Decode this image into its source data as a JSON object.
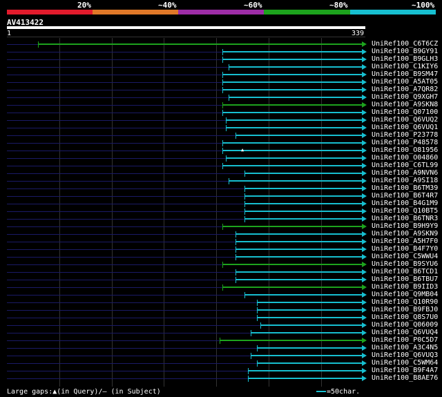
{
  "legend": {
    "segments": [
      {
        "label": "20%",
        "color": "#e21b2c"
      },
      {
        "label": "~40%",
        "color": "#e07828"
      },
      {
        "label": "~60%",
        "color": "#9d2da6"
      },
      {
        "label": "~80%",
        "color": "#1da31d"
      },
      {
        "label": "~100%",
        "color": "#17bfd0"
      }
    ]
  },
  "query": {
    "id": "AV413422",
    "start": "1",
    "end": "339",
    "length": 339
  },
  "colors": {
    "cyan": "#17bfd0",
    "green": "#1da31d",
    "track": "#1a1a66"
  },
  "hits": [
    {
      "name": "UniRef100_C6T6CZ",
      "start": 30,
      "color": "green"
    },
    {
      "name": "UniRef100_B9GY91",
      "start": 206,
      "color": "cyan"
    },
    {
      "name": "UniRef100_B9GLH3",
      "start": 206,
      "color": "cyan"
    },
    {
      "name": "UniRef100_C1KIY6",
      "start": 212,
      "color": "cyan"
    },
    {
      "name": "UniRef100_B9SM47",
      "start": 206,
      "color": "cyan"
    },
    {
      "name": "UniRef100_A5AT05",
      "start": 206,
      "color": "cyan"
    },
    {
      "name": "UniRef100_A7QR82",
      "start": 206,
      "color": "cyan"
    },
    {
      "name": "UniRef100_Q9XGH7",
      "start": 212,
      "color": "cyan"
    },
    {
      "name": "UniRef100_A9SKN8",
      "start": 206,
      "color": "green"
    },
    {
      "name": "UniRef100_Q07100",
      "start": 206,
      "color": "cyan"
    },
    {
      "name": "UniRef100_Q6VUQ2",
      "start": 209,
      "color": "cyan"
    },
    {
      "name": "UniRef100_Q6VUQ1",
      "start": 209,
      "color": "cyan"
    },
    {
      "name": "UniRef100_P23778",
      "start": 218,
      "color": "cyan"
    },
    {
      "name": "UniRef100_P48578",
      "start": 206,
      "color": "cyan"
    },
    {
      "name": "UniRef100_O81956",
      "start": 206,
      "color": "cyan",
      "gap": true
    },
    {
      "name": "UniRef100_O04860",
      "start": 209,
      "color": "cyan"
    },
    {
      "name": "UniRef100_C6TL99",
      "start": 206,
      "color": "cyan"
    },
    {
      "name": "UniRef100_A9NVN6",
      "start": 227,
      "color": "cyan"
    },
    {
      "name": "UniRef100_A9SI18",
      "start": 212,
      "color": "cyan"
    },
    {
      "name": "UniRef100_B6TM39",
      "start": 227,
      "color": "cyan"
    },
    {
      "name": "UniRef100_B6T4R7",
      "start": 227,
      "color": "cyan"
    },
    {
      "name": "UniRef100_B4G1M9",
      "start": 227,
      "color": "cyan"
    },
    {
      "name": "UniRef100_Q10BT5",
      "start": 227,
      "color": "cyan"
    },
    {
      "name": "UniRef100_B6TNR3",
      "start": 227,
      "color": "cyan"
    },
    {
      "name": "UniRef100_B9H9Y9",
      "start": 206,
      "color": "green"
    },
    {
      "name": "UniRef100_A9SKN9",
      "start": 218,
      "color": "cyan"
    },
    {
      "name": "UniRef100_A5H7F0",
      "start": 218,
      "color": "cyan"
    },
    {
      "name": "UniRef100_B4F7Y0",
      "start": 218,
      "color": "cyan"
    },
    {
      "name": "UniRef100_C5WWU4",
      "start": 218,
      "color": "cyan"
    },
    {
      "name": "UniRef100_B9SYU6",
      "start": 206,
      "color": "green"
    },
    {
      "name": "UniRef100_B6TCD1",
      "start": 218,
      "color": "cyan"
    },
    {
      "name": "UniRef100_B6TBU7",
      "start": 218,
      "color": "cyan"
    },
    {
      "name": "UniRef100_B9IID3",
      "start": 206,
      "color": "green"
    },
    {
      "name": "UniRef100_Q9MB04",
      "start": 227,
      "color": "cyan"
    },
    {
      "name": "UniRef100_Q10R90",
      "start": 239,
      "color": "cyan"
    },
    {
      "name": "UniRef100_B9FBJ0",
      "start": 239,
      "color": "cyan"
    },
    {
      "name": "UniRef100_Q8S7U0",
      "start": 239,
      "color": "cyan"
    },
    {
      "name": "UniRef100_Q06009",
      "start": 242,
      "color": "cyan"
    },
    {
      "name": "UniRef100_Q6VUQ4",
      "start": 233,
      "color": "cyan"
    },
    {
      "name": "UniRef100_P0C5D7",
      "start": 203,
      "color": "green"
    },
    {
      "name": "UniRef100_A3C4N5",
      "start": 239,
      "color": "cyan"
    },
    {
      "name": "UniRef100_Q6VUQ3",
      "start": 233,
      "color": "cyan"
    },
    {
      "name": "UniRef100_C5WM64",
      "start": 239,
      "color": "cyan"
    },
    {
      "name": "UniRef100_B9F4A7",
      "start": 230,
      "color": "cyan"
    },
    {
      "name": "UniRef100_B8AE76",
      "start": 230,
      "color": "cyan"
    }
  ],
  "footer": {
    "gaps_label": "Large gaps:▲(in Query)/– (in Subject)",
    "scale_label": "=50char."
  }
}
